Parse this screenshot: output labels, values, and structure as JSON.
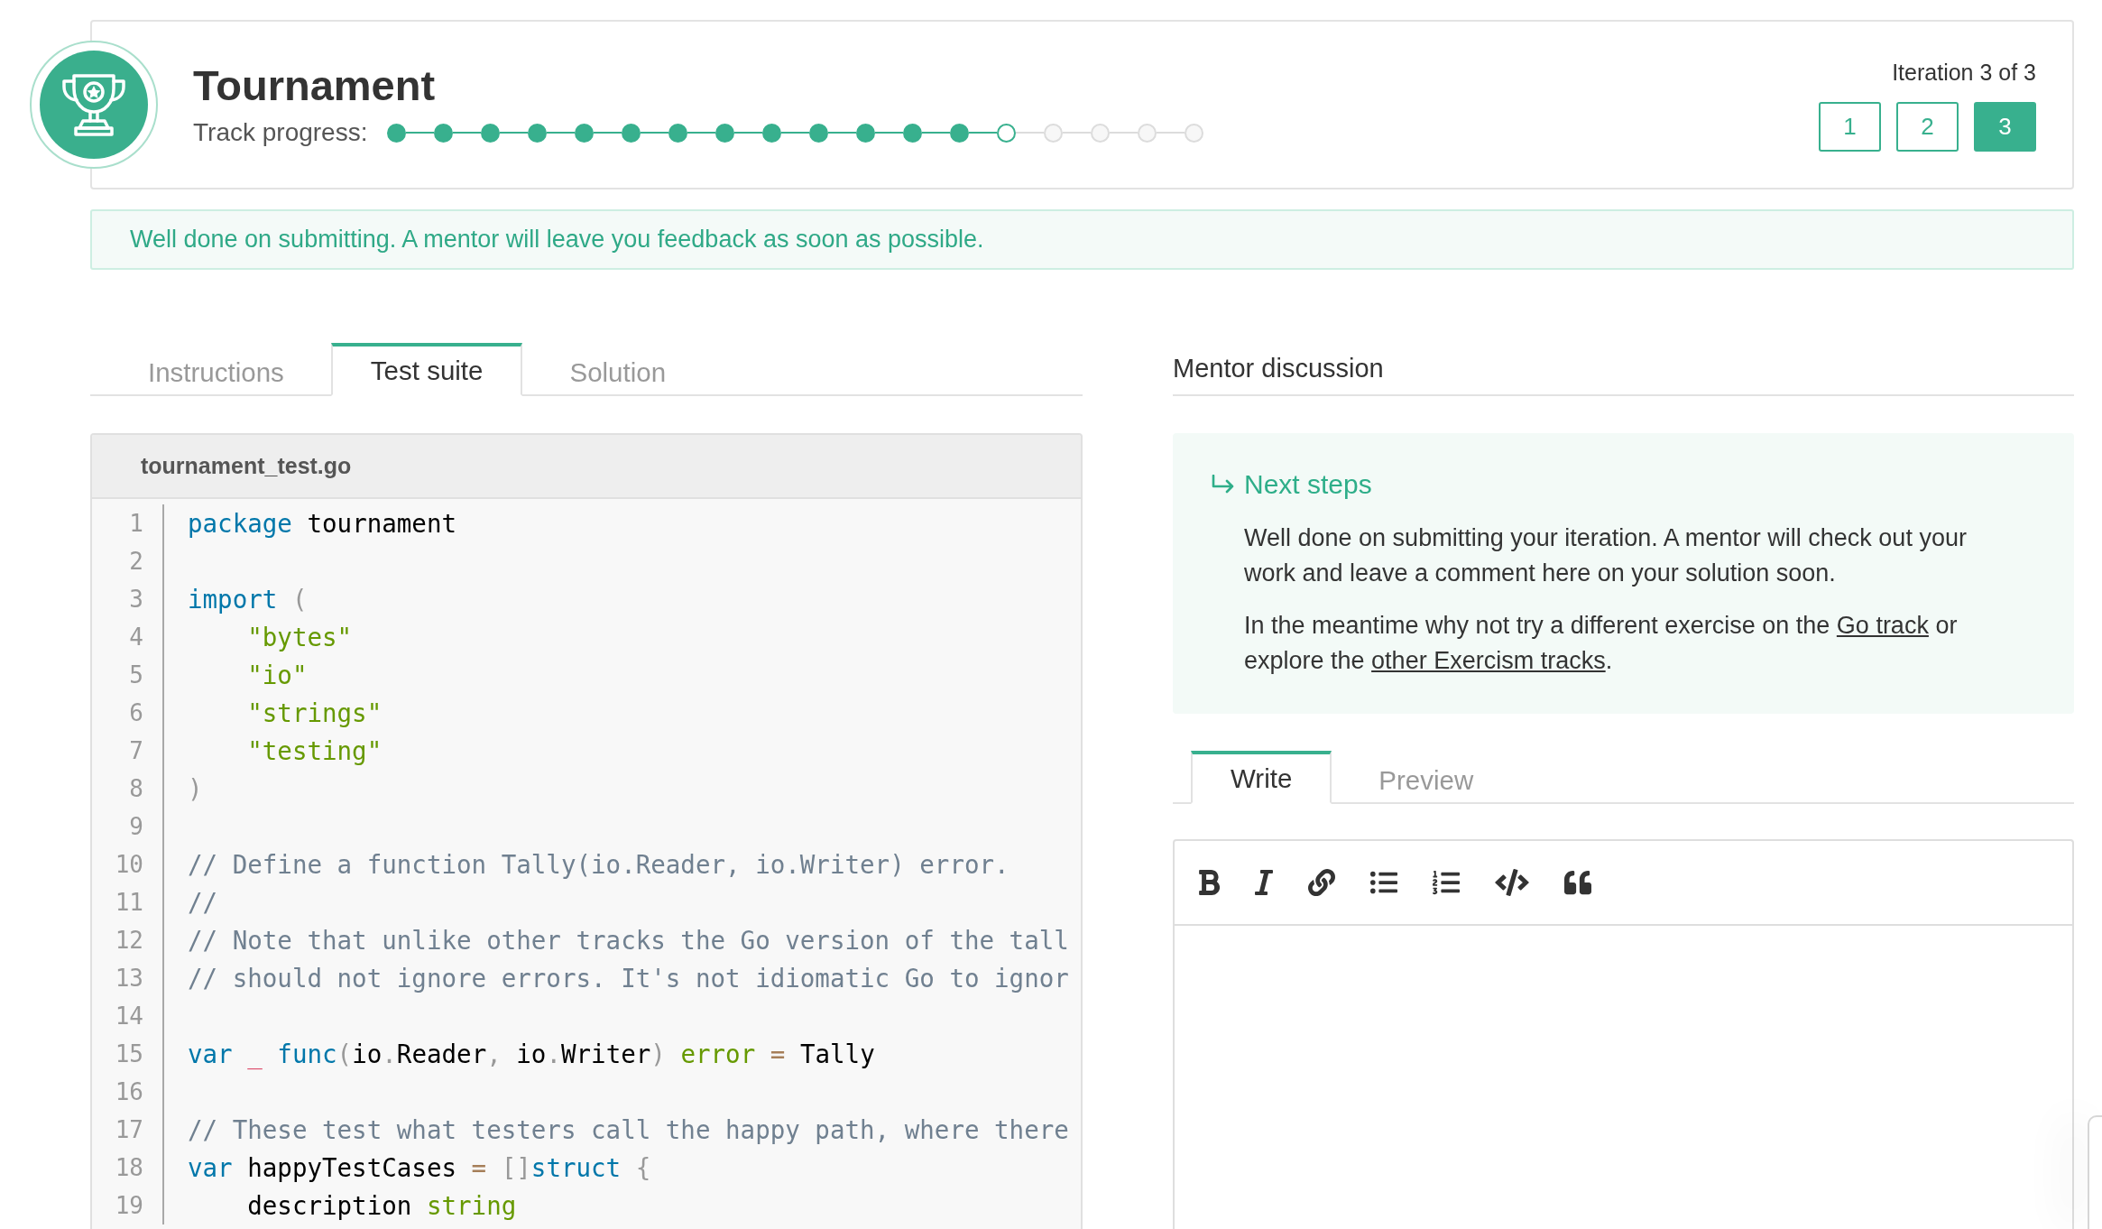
{
  "exercise": {
    "title": "Tournament",
    "progress_label": "Track progress:",
    "progress_steps": [
      {
        "completed": true,
        "current": false
      },
      {
        "completed": true,
        "current": false
      },
      {
        "completed": true,
        "current": false
      },
      {
        "completed": true,
        "current": false
      },
      {
        "completed": true,
        "current": false
      },
      {
        "completed": true,
        "current": false
      },
      {
        "completed": true,
        "current": false
      },
      {
        "completed": true,
        "current": false
      },
      {
        "completed": true,
        "current": false
      },
      {
        "completed": true,
        "current": false
      },
      {
        "completed": true,
        "current": false
      },
      {
        "completed": true,
        "current": false
      },
      {
        "completed": true,
        "current": false
      },
      {
        "completed": false,
        "current": true
      },
      {
        "completed": false,
        "current": false
      },
      {
        "completed": false,
        "current": false
      },
      {
        "completed": false,
        "current": false
      },
      {
        "completed": false,
        "current": false
      }
    ]
  },
  "iterations": {
    "label": "Iteration 3 of 3",
    "buttons": [
      {
        "label": "1",
        "selected": false
      },
      {
        "label": "2",
        "selected": false
      },
      {
        "label": "3",
        "selected": true
      }
    ]
  },
  "notice": "Well done on submitting. A mentor will leave you feedback as soon as possible.",
  "solution_tabs": [
    {
      "label": "Instructions",
      "selected": false
    },
    {
      "label": "Test suite",
      "selected": true
    },
    {
      "label": "Solution",
      "selected": false
    }
  ],
  "code_file": {
    "filename": "tournament_test.go",
    "lines": [
      {
        "number": "1",
        "tokens": [
          {
            "kind": "keyword",
            "text": "package"
          },
          {
            "kind": "plain",
            "text": " tournament"
          }
        ]
      },
      {
        "number": "2"
      },
      {
        "number": "3",
        "tokens": [
          {
            "kind": "keyword",
            "text": "import"
          },
          {
            "kind": "punct",
            "text": " ("
          }
        ]
      },
      {
        "number": "4",
        "tokens": [
          {
            "kind": "string",
            "text": "    \"bytes\""
          }
        ]
      },
      {
        "number": "5",
        "tokens": [
          {
            "kind": "string",
            "text": "    \"io\""
          }
        ]
      },
      {
        "number": "6",
        "tokens": [
          {
            "kind": "string",
            "text": "    \"strings\""
          }
        ]
      },
      {
        "number": "7",
        "tokens": [
          {
            "kind": "string",
            "text": "    \"testing\""
          }
        ]
      },
      {
        "number": "8",
        "tokens": [
          {
            "kind": "punct",
            "text": ")"
          }
        ]
      },
      {
        "number": "9"
      },
      {
        "number": "10",
        "tokens": [
          {
            "kind": "comment",
            "text": "// Define a function Tally(io.Reader, io.Writer) error."
          }
        ]
      },
      {
        "number": "11",
        "tokens": [
          {
            "kind": "comment",
            "text": "//"
          }
        ]
      },
      {
        "number": "12",
        "tokens": [
          {
            "kind": "comment",
            "text": "// Note that unlike other tracks the Go version of the tall"
          }
        ]
      },
      {
        "number": "13",
        "tokens": [
          {
            "kind": "comment",
            "text": "// should not ignore errors. It's not idiomatic Go to ignor"
          }
        ]
      },
      {
        "number": "14"
      },
      {
        "number": "15",
        "tokens": [
          {
            "kind": "keyword",
            "text": "var"
          },
          {
            "kind": "special",
            "text": " _"
          },
          {
            "kind": "keyword",
            "text": " func"
          },
          {
            "kind": "punct",
            "text": "("
          },
          {
            "kind": "plain",
            "text": "io"
          },
          {
            "kind": "punct",
            "text": "."
          },
          {
            "kind": "plain",
            "text": "Reader"
          },
          {
            "kind": "punct",
            "text": ","
          },
          {
            "kind": "plain",
            "text": " io"
          },
          {
            "kind": "punct",
            "text": "."
          },
          {
            "kind": "plain",
            "text": "Writer"
          },
          {
            "kind": "punct",
            "text": ")"
          },
          {
            "kind": "builtin",
            "text": " error"
          },
          {
            "kind": "operator",
            "text": " ="
          },
          {
            "kind": "plain",
            "text": " Tally"
          }
        ]
      },
      {
        "number": "16"
      },
      {
        "number": "17",
        "tokens": [
          {
            "kind": "comment",
            "text": "// These test what testers call the happy path, where there"
          }
        ]
      },
      {
        "number": "18",
        "tokens": [
          {
            "kind": "keyword",
            "text": "var"
          },
          {
            "kind": "plain",
            "text": " happyTestCases"
          },
          {
            "kind": "operator",
            "text": " ="
          },
          {
            "kind": "punct",
            "text": " []"
          },
          {
            "kind": "keyword",
            "text": "struct"
          },
          {
            "kind": "punct",
            "text": " {"
          }
        ]
      },
      {
        "number": "19",
        "tokens": [
          {
            "kind": "plain",
            "text": "    description"
          },
          {
            "kind": "builtin",
            "text": " string"
          }
        ]
      }
    ]
  },
  "mentor_discussion": {
    "title": "Mentor discussion",
    "next_steps": {
      "title": "Next steps",
      "paragraphs": [
        {
          "parts": [
            {
              "kind": "text",
              "text": "Well done on submitting your iteration. A mentor will check out your work and leave a comment here on your solution soon."
            }
          ]
        },
        {
          "parts": [
            {
              "kind": "text",
              "text": "In the meantime why not try a different exercise on the "
            },
            {
              "kind": "link",
              "text": "Go track"
            },
            {
              "kind": "text",
              "text": " or explore the "
            },
            {
              "kind": "link",
              "text": "other Exercism tracks"
            },
            {
              "kind": "text",
              "text": "."
            }
          ]
        }
      ]
    }
  },
  "comment_tabs": [
    {
      "label": "Write",
      "selected": true
    },
    {
      "label": "Preview",
      "selected": false
    }
  ]
}
